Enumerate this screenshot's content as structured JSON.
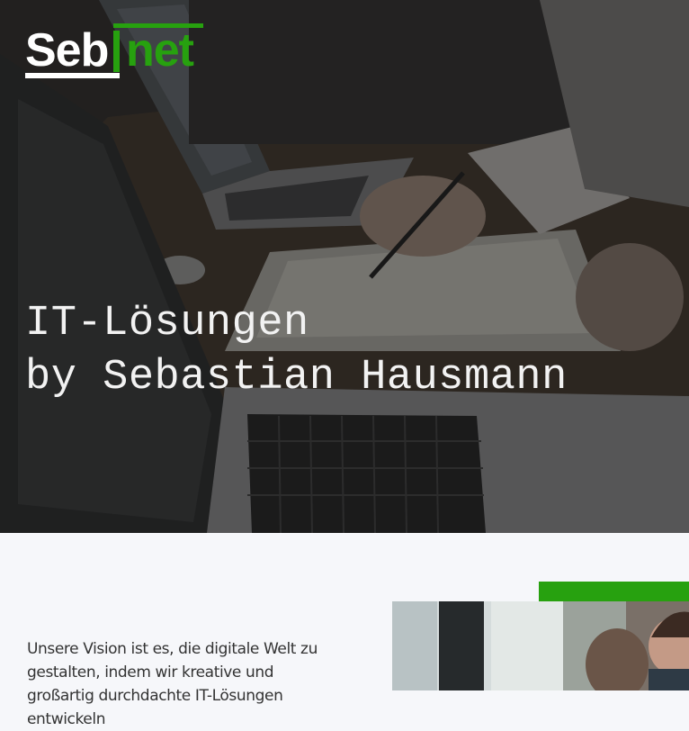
{
  "logo": {
    "text_part1": "Seb",
    "text_part2": "net",
    "alt": "Sebinet"
  },
  "hero": {
    "headline_line1": "IT-Lösungen",
    "headline_line2": "by Sebastian Hausmann"
  },
  "intro": {
    "vision_text": "Unsere Vision ist es, die digitale Welt zu gestalten, indem wir kreative und großartig durchdachte IT-Lösungen entwickeln"
  },
  "colors": {
    "brand_green": "#27a10f",
    "hero_text": "#f2f2f2",
    "body_text": "#333333",
    "section_bg": "#f6f7fa"
  }
}
